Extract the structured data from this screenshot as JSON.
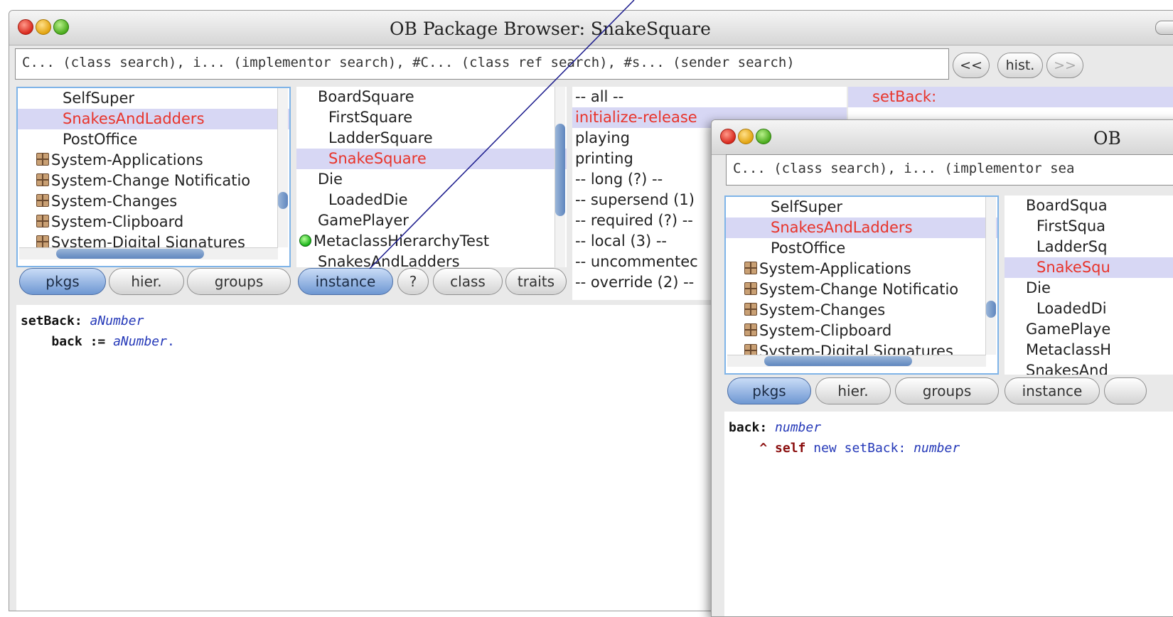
{
  "browser": {
    "title": "OB Package Browser: SnakeSquare",
    "search_placeholder": "C... (class search), i... (implementor search), #C... (class ref search), #s... (sender search)",
    "nav": {
      "back": "<<",
      "history": "hist.",
      "forward": ">>"
    },
    "packages": [
      {
        "label": "SelfSuper",
        "kind": "class"
      },
      {
        "label": "SnakesAndLadders",
        "kind": "class"
      },
      {
        "label": "PostOffice",
        "kind": "class"
      },
      {
        "label": "System-Applications",
        "kind": "package"
      },
      {
        "label": "System-Change Notificatio",
        "kind": "package"
      },
      {
        "label": "System-Changes",
        "kind": "package"
      },
      {
        "label": "System-Clipboard",
        "kind": "package"
      },
      {
        "label": "System-Digital Signatures",
        "kind": "package"
      }
    ],
    "classes": [
      "BoardSquare",
      "FirstSquare",
      "LadderSquare",
      "SnakeSquare",
      "Die",
      "LoadedDie",
      "GamePlayer",
      "MetaclassHierarchyTest",
      "SnakesAndLadders"
    ],
    "categories": [
      "-- all --",
      "initialize-release",
      "playing",
      "printing",
      "-- long (?) --",
      "-- supersend (1)",
      "-- required (?) --",
      "-- local (3) --",
      "-- uncommentec",
      "-- override (2) --"
    ],
    "methods": [
      "setBack:"
    ],
    "left_buttons": [
      "pkgs",
      "hier.",
      "groups"
    ],
    "right_buttons": [
      "instance",
      "?",
      "class",
      "traits"
    ],
    "code": {
      "selector": "setBack:",
      "arg": "aNumber",
      "body_var": "back",
      "assign": ":=",
      "body_arg": "aNumber",
      "dot": "."
    }
  },
  "browser2": {
    "title": "OB",
    "search_placeholder": "C... (class search), i... (implementor sea",
    "packages": [
      {
        "label": "SelfSuper",
        "kind": "class"
      },
      {
        "label": "SnakesAndLadders",
        "kind": "class"
      },
      {
        "label": "PostOffice",
        "kind": "class"
      },
      {
        "label": "System-Applications",
        "kind": "package"
      },
      {
        "label": "System-Change Notificatio",
        "kind": "package"
      },
      {
        "label": "System-Changes",
        "kind": "package"
      },
      {
        "label": "System-Clipboard",
        "kind": "package"
      },
      {
        "label": "System-Digital Signatures",
        "kind": "package"
      }
    ],
    "classes": [
      "BoardSqua",
      "FirstSqua",
      "LadderSq",
      "SnakeSqu",
      "Die",
      "LoadedDi",
      "GamePlaye",
      "MetaclassH",
      "SnakesAnd"
    ],
    "left_buttons": [
      "pkgs",
      "hier.",
      "groups"
    ],
    "right_buttons": [
      "instance"
    ],
    "code": {
      "selector": "back:",
      "arg": "number",
      "caret": "^",
      "self": "self",
      "msg1": "new",
      "msg2": "setBack:",
      "arg2": "number"
    }
  },
  "colors": {
    "selected_text": "#e8342b",
    "selected_row": "#d7d7f4",
    "active_button": "#6e97d2",
    "annotation_line": "#1a1a8c"
  }
}
